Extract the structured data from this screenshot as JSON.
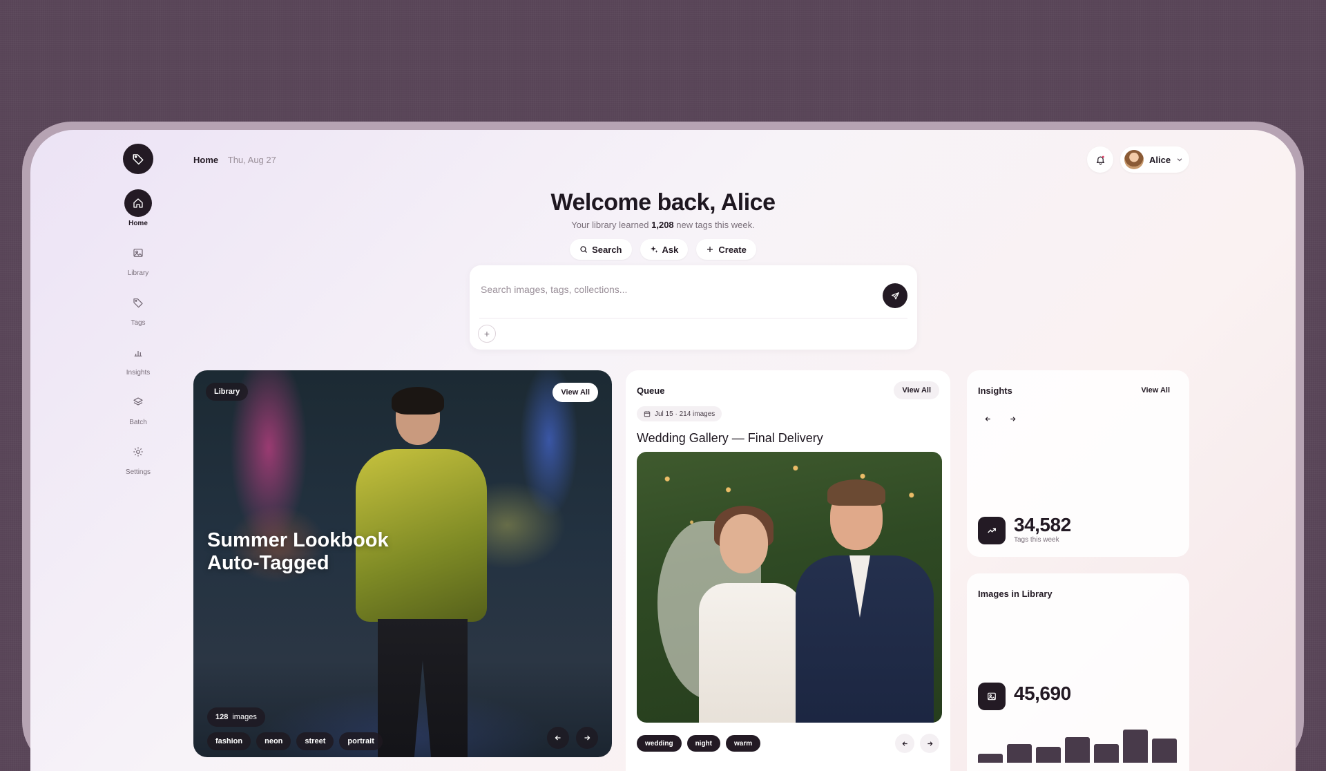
{
  "app": {
    "name": "Image tagging dashboard"
  },
  "breadcrumb": {
    "home": "Home",
    "date": "Thu, Aug 27"
  },
  "sidebar": {
    "items": [
      {
        "label": "Home",
        "icon": "home-icon",
        "active": true
      },
      {
        "label": "Library",
        "icon": "image-icon",
        "active": false
      },
      {
        "label": "Tags",
        "icon": "tag-icon",
        "active": false
      },
      {
        "label": "Insights",
        "icon": "bar-chart-icon",
        "active": false
      },
      {
        "label": "Batch",
        "icon": "layers-icon",
        "active": false
      },
      {
        "label": "Settings",
        "icon": "gear-icon",
        "active": false
      }
    ]
  },
  "user": {
    "name": "Alice"
  },
  "hero": {
    "title": "Welcome back, Alice",
    "subtitle_pre": "Your library learned",
    "subtitle_count": "1,208",
    "subtitle_post": "new tags this week."
  },
  "actions": [
    {
      "label": "Search",
      "icon": "search-icon"
    },
    {
      "label": "Ask",
      "icon": "sparkle-icon"
    },
    {
      "label": "Create",
      "icon": "plus-icon"
    }
  ],
  "search": {
    "placeholder": "Search images, tags, collections..."
  },
  "library_card": {
    "tag": "Library",
    "view_all": "View All",
    "title_line1": "Summer Lookbook",
    "title_line2": "Auto-Tagged",
    "count": "128",
    "count_unit": "images",
    "tags": [
      "fashion",
      "neon",
      "street",
      "portrait"
    ]
  },
  "queue_card": {
    "title": "Queue",
    "view_all": "View All",
    "meta": "Jul 15 · 214 images",
    "gallery_title": "Wedding Gallery — Final Delivery",
    "tags": [
      "wedding",
      "night",
      "warm"
    ]
  },
  "insights_card": {
    "title": "Insights",
    "view_all": "View All",
    "value": "34,582",
    "caption": "Tags this week"
  },
  "images_card": {
    "title": "Images in Library",
    "value": "45,690",
    "bar_values": [
      0.22,
      0.45,
      0.38,
      0.62,
      0.45,
      0.8,
      0.58
    ]
  },
  "colors": {
    "accent_dark": "#231a24",
    "background": "#584457",
    "bar": "#483a4a"
  }
}
